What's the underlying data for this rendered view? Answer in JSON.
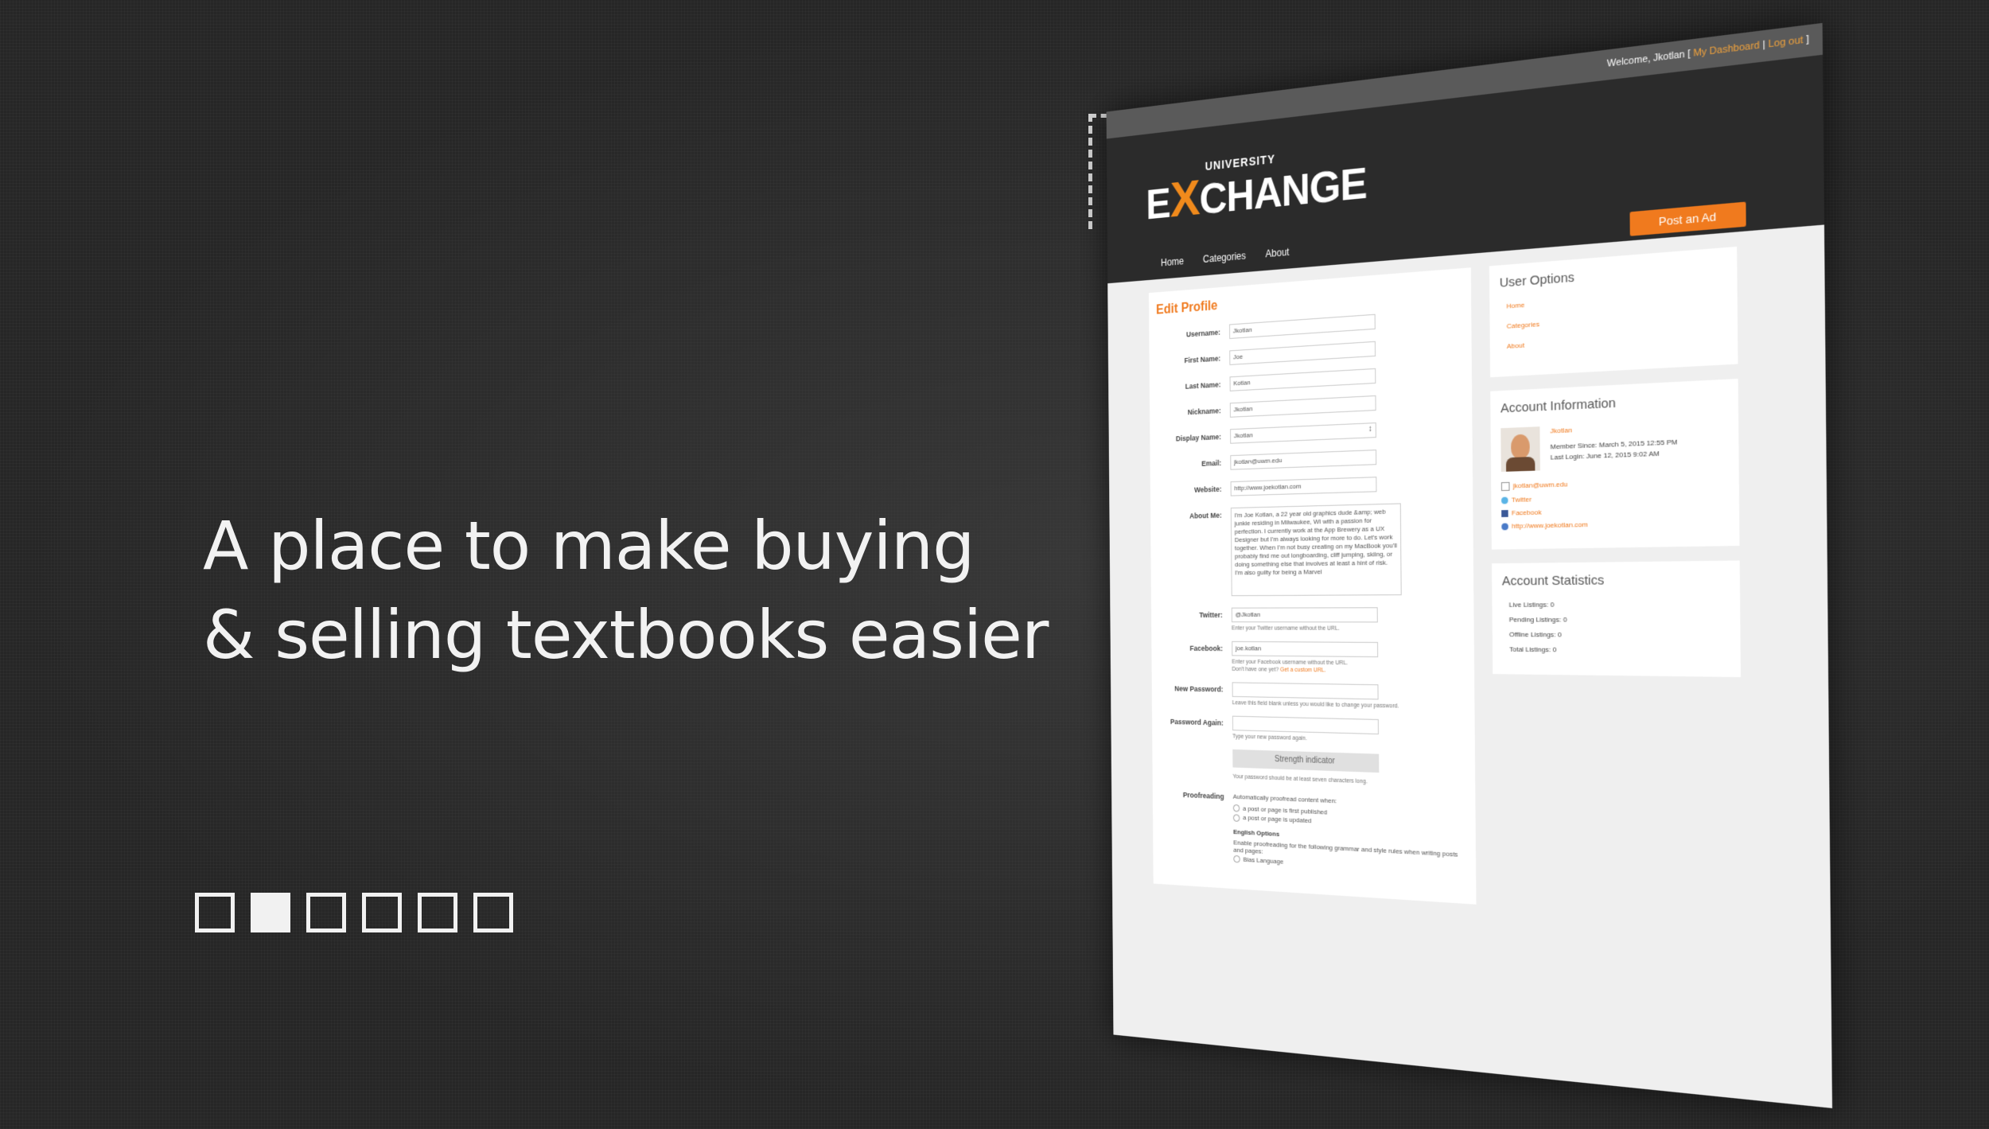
{
  "tagline": {
    "line1": "A place to make buying",
    "line2": "& selling textbooks easier"
  },
  "slides": {
    "count": 6,
    "active_index": 1
  },
  "site": {
    "topbar": {
      "welcome": "Welcome, Jkotlan",
      "dashboard": "My Dashboard",
      "logout": "Log out"
    },
    "logo": {
      "small": "UNIVERSITY",
      "main_e": "E",
      "main_x": "X",
      "main_rest": "CHANGE"
    },
    "nav": [
      "Home",
      "Categories",
      "About"
    ],
    "post_button": "Post an Ad",
    "edit_profile": {
      "title": "Edit Profile",
      "fields": [
        {
          "label": "Username:",
          "value": "Jkotlan"
        },
        {
          "label": "First Name:",
          "value": "Joe"
        },
        {
          "label": "Last Name:",
          "value": "Kotlan"
        },
        {
          "label": "Nickname:",
          "value": "Jkotlan"
        },
        {
          "label": "Display Name:",
          "value": "Jkotlan"
        },
        {
          "label": "Email:",
          "value": "jkotlan@uwm.edu"
        },
        {
          "label": "Website:",
          "value": "http://www.joekotlan.com"
        }
      ],
      "about_label": "About Me:",
      "about_text": "I'm Joe Kotlan, a 22 year old graphics dude &amp; web junkie residing in Milwaukee, WI with a passion for perfection. I currently work at the App Brewery as a UX Designer but I'm always looking for more to do. Let's work together. When I'm not busy creating on my MacBook you'll probably find me out longboarding, cliff jumping, skiing, or doing something else that involves at least a hint of risk. I'm also guilty for being a Marvel",
      "twitter_label": "Twitter:",
      "twitter_value": "@Jkotlan",
      "twitter_hint": "Enter your Twitter username without the URL.",
      "facebook_label": "Facebook:",
      "facebook_value": "joe.kotlan",
      "facebook_hint": "Enter your Facebook username without the URL.",
      "facebook_hint2": "Don't have one yet?",
      "facebook_hint_link": "Get a custom URL.",
      "newpass_label": "New Password:",
      "newpass_hint": "Leave this field blank unless you would like to change your password.",
      "passagain_label": "Password Again:",
      "passagain_hint": "Type your new password again.",
      "strength": "Strength indicator",
      "strength_hint": "Your password should be at least seven characters long.",
      "proof_label": "Proofreading",
      "proof_desc": "Automatically proofread content when:",
      "proof_opt1": "a post or page is first published",
      "proof_opt2": "a post or page is updated",
      "english_options": "English Options",
      "english_desc": "Enable proofreading for the following grammar and style rules when writing posts and pages:",
      "bias": "Bias Language"
    },
    "user_options": {
      "title": "User Options",
      "items": [
        "Home",
        "Categories",
        "About"
      ]
    },
    "account_info": {
      "title": "Account Information",
      "name": "Jkotlan",
      "member_since": "Member Since: March 5, 2015 12:55 PM",
      "last_login": "Last Login: June 12, 2015 9:02 AM",
      "links": [
        "jkotlan@uwm.edu",
        "Twitter",
        "Facebook",
        "http://www.joekotlan.com"
      ]
    },
    "account_stats": {
      "title": "Account Statistics",
      "items": [
        "Live Listings: 0",
        "Pending Listings: 0",
        "Offline Listings: 0",
        "Total Listings: 0"
      ]
    }
  },
  "colors": {
    "accent": "#f07a1e",
    "background": "#262626",
    "header": "#2b2b2b"
  }
}
